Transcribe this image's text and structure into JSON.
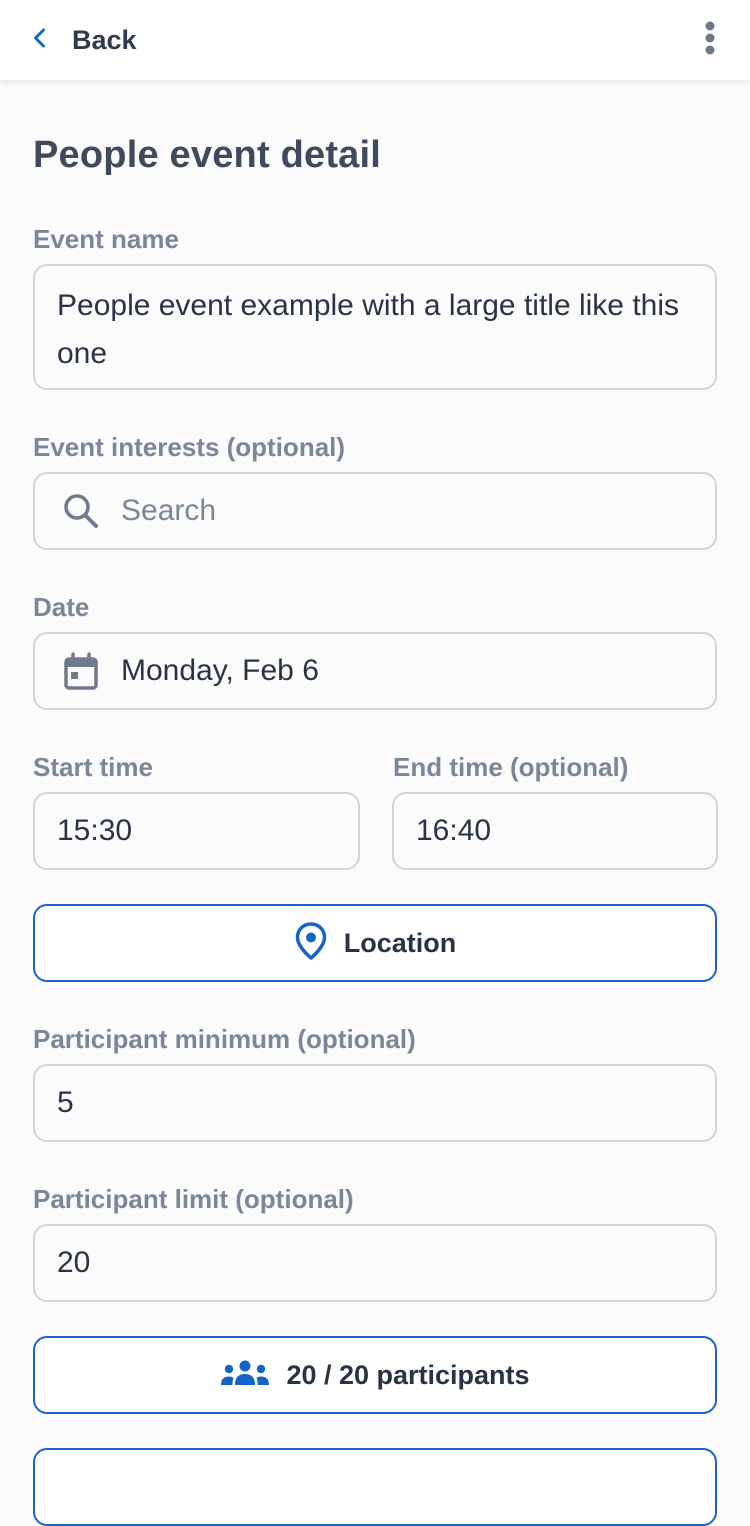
{
  "header": {
    "back_label": "Back",
    "accent": "#1664c8"
  },
  "page": {
    "title": "People event detail"
  },
  "form": {
    "event_name": {
      "label": "Event name",
      "value": "People event example with a large title like this one"
    },
    "interests": {
      "label": "Event interests (optional)",
      "placeholder": "Search",
      "icon": "search-icon"
    },
    "date": {
      "label": "Date",
      "value": "Monday, Feb 6",
      "icon": "calendar-icon"
    },
    "start_time": {
      "label": "Start time",
      "value": "15:30"
    },
    "end_time": {
      "label": "End time (optional)",
      "value": "16:40"
    },
    "location_button": {
      "label": "Location",
      "icon": "map-pin-icon"
    },
    "participant_min": {
      "label": "Participant minimum (optional)",
      "value": "5"
    },
    "participant_limit": {
      "label": "Participant limit (optional)",
      "value": "20"
    },
    "participants_button": {
      "label": "20 / 20 participants",
      "icon": "people-icon"
    }
  }
}
